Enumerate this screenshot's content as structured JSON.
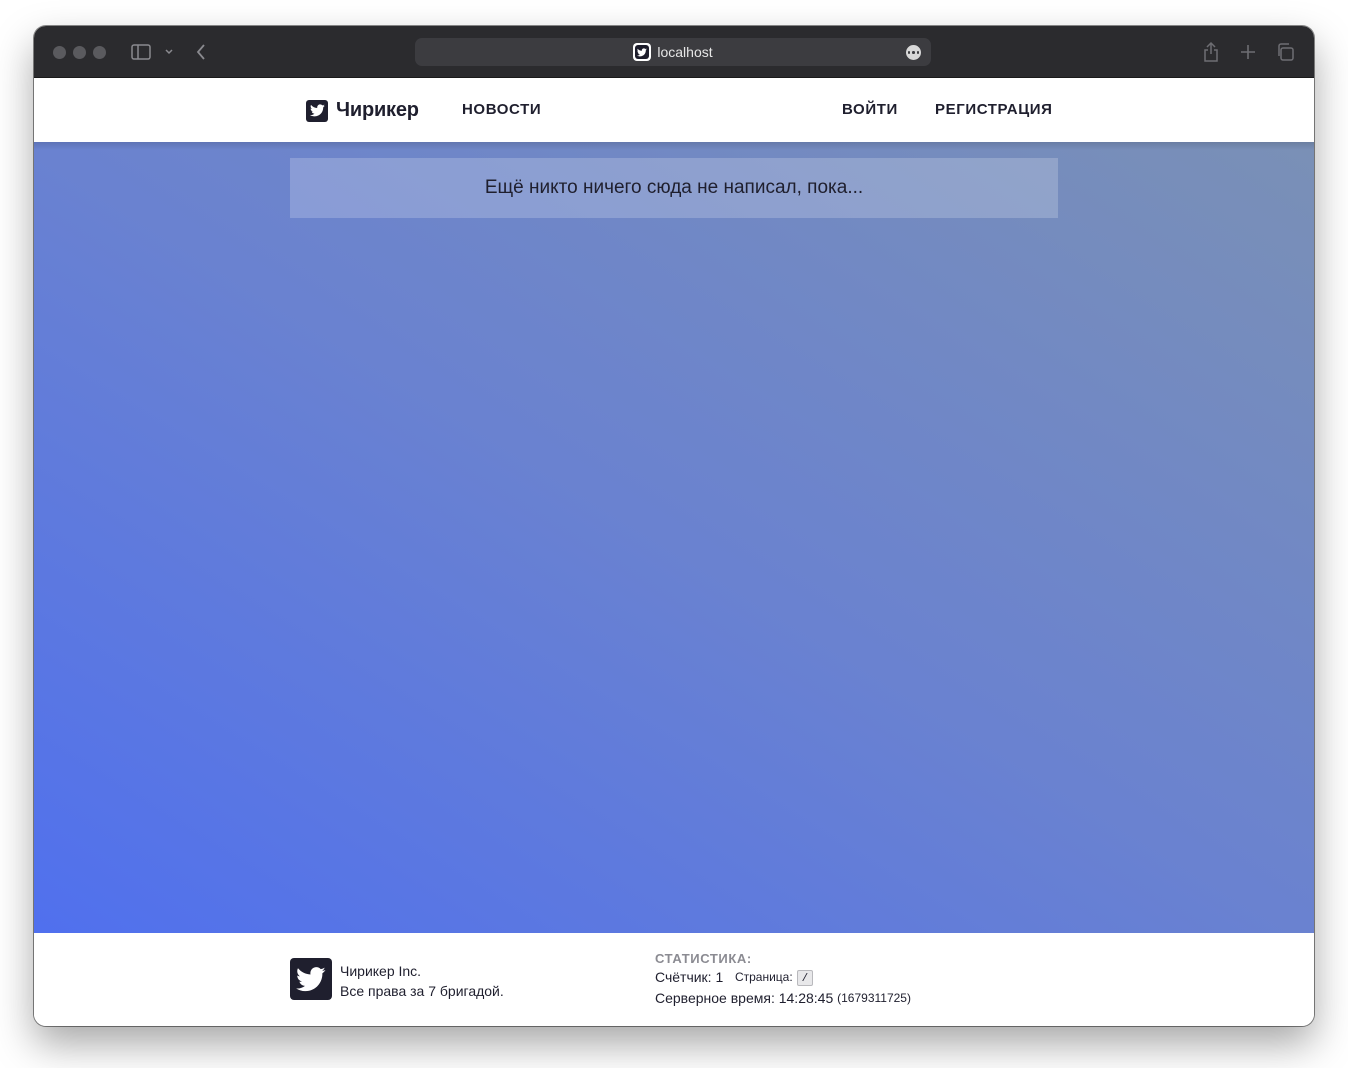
{
  "browser": {
    "url": "localhost",
    "icons": {
      "sidebar": "sidebar-icon",
      "chevron": "chevron-down-icon",
      "back": "chevron-left-icon",
      "share": "share-icon",
      "new_tab": "plus-icon",
      "tabs": "tabs-overview-icon",
      "more": "ellipsis-icon"
    }
  },
  "header": {
    "brand": "Чирикер",
    "nav": {
      "news": "НОВОСТИ",
      "login": "ВОЙТИ",
      "register": "РЕГИСТРАЦИЯ"
    }
  },
  "main": {
    "empty_message": "Ещё никто ничего сюда не написал, пока..."
  },
  "footer": {
    "company": "Чирикер Inc.",
    "rights": "Все права за 7 бригадой.",
    "stats": {
      "title": "СТАТИСТИКА:",
      "counter_label": "Счётчик:",
      "counter_value": "1",
      "page_label": "Страница:",
      "page_value": "/",
      "server_time_label": "Серверное время:",
      "server_time": "14:28:45",
      "timestamp": "(1679311725)"
    }
  },
  "colors": {
    "gradient_start": "#5070ee",
    "gradient_end": "#7a90b6",
    "brand_dark": "#1f1f2e",
    "toolbar": "#2b2b2e"
  }
}
